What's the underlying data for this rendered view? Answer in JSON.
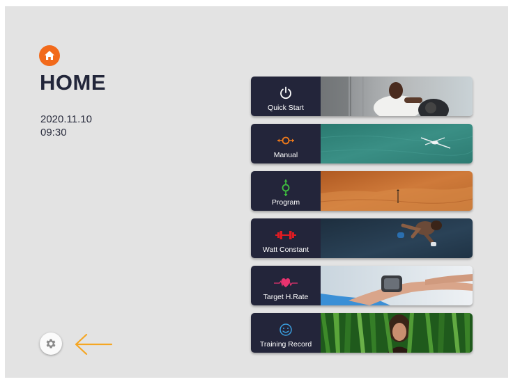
{
  "header": {
    "home_icon": "home-icon",
    "title": "HOME",
    "date": "2020.11.10",
    "time": "09:30"
  },
  "menu": [
    {
      "label": "Quick Start",
      "icon": "power-icon",
      "icon_color": "#ffffff"
    },
    {
      "label": "Manual",
      "icon": "manual-adjust-icon",
      "icon_color": "#f07a1a"
    },
    {
      "label": "Program",
      "icon": "program-icon",
      "icon_color": "#3fbf3f"
    },
    {
      "label": "Watt Constant",
      "icon": "dumbbell-icon",
      "icon_color": "#e01b22"
    },
    {
      "label": "Target H.Rate",
      "icon": "heart-rate-icon",
      "icon_color": "#e8336f"
    },
    {
      "label": "Training Record",
      "icon": "smiley-icon",
      "icon_color": "#3a9fe0"
    }
  ],
  "footer": {
    "settings_icon": "gear-icon",
    "back_icon": "arrow-left-icon",
    "accent": "#f5a623"
  },
  "colors": {
    "background": "#e3e3e3",
    "panel": "#23253a",
    "home_accent": "#f26a1b"
  }
}
